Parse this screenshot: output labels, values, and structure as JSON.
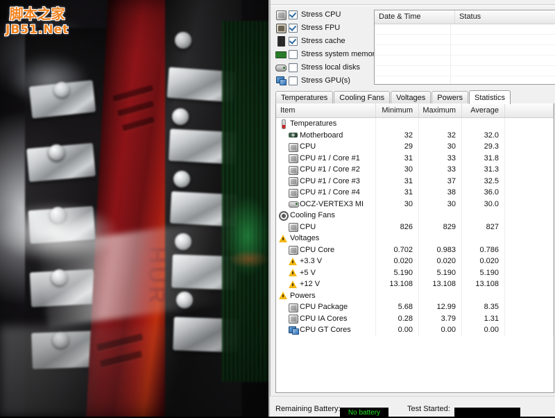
{
  "watermark": {
    "line1": "脚本之家",
    "line2": "JB51.Net"
  },
  "photo": {
    "alt": "blurred photo of frost-covered RAM heatsinks and motherboard"
  },
  "stress_options": [
    {
      "label": "Stress CPU",
      "icon": "cpu-icon",
      "checked": true
    },
    {
      "label": "Stress FPU",
      "icon": "fpu-icon",
      "checked": true
    },
    {
      "label": "Stress cache",
      "icon": "cache-icon",
      "checked": true
    },
    {
      "label": "Stress system memory",
      "icon": "memory-icon",
      "checked": false
    },
    {
      "label": "Stress local disks",
      "icon": "disk-icon",
      "checked": false
    },
    {
      "label": "Stress GPU(s)",
      "icon": "gpu-icon",
      "checked": false
    }
  ],
  "log": {
    "columns": [
      "Date & Time",
      "Status"
    ],
    "rows": []
  },
  "tabs": [
    {
      "label": "Temperatures",
      "active": false
    },
    {
      "label": "Cooling Fans",
      "active": false
    },
    {
      "label": "Voltages",
      "active": false
    },
    {
      "label": "Powers",
      "active": false
    },
    {
      "label": "Statistics",
      "active": true
    }
  ],
  "statistics": {
    "columns": [
      "Item",
      "Minimum",
      "Maximum",
      "Average"
    ],
    "rows": [
      {
        "type": "group",
        "icon": "thermometer-icon",
        "label": "Temperatures",
        "min": "",
        "max": "",
        "avg": ""
      },
      {
        "type": "item",
        "icon": "motherboard-icon",
        "label": "Motherboard",
        "min": "32",
        "max": "32",
        "avg": "32.0"
      },
      {
        "type": "item",
        "icon": "chip-icon",
        "label": "CPU",
        "min": "29",
        "max": "30",
        "avg": "29.3"
      },
      {
        "type": "item",
        "icon": "chip-icon",
        "label": "CPU #1 / Core #1",
        "min": "31",
        "max": "33",
        "avg": "31.8"
      },
      {
        "type": "item",
        "icon": "chip-icon",
        "label": "CPU #1 / Core #2",
        "min": "30",
        "max": "33",
        "avg": "31.3"
      },
      {
        "type": "item",
        "icon": "chip-icon",
        "label": "CPU #1 / Core #3",
        "min": "31",
        "max": "37",
        "avg": "32.5"
      },
      {
        "type": "item",
        "icon": "chip-icon",
        "label": "CPU #1 / Core #4",
        "min": "31",
        "max": "38",
        "avg": "36.0"
      },
      {
        "type": "item",
        "icon": "ssd-icon",
        "label": "OCZ-VERTEX3 MI",
        "min": "30",
        "max": "30",
        "avg": "30.0"
      },
      {
        "type": "group",
        "icon": "fan-icon",
        "label": "Cooling Fans",
        "min": "",
        "max": "",
        "avg": ""
      },
      {
        "type": "item",
        "icon": "chip-icon",
        "label": "CPU",
        "min": "826",
        "max": "829",
        "avg": "827"
      },
      {
        "type": "group",
        "icon": "warning-icon",
        "label": "Voltages",
        "min": "",
        "max": "",
        "avg": ""
      },
      {
        "type": "item",
        "icon": "chip-icon",
        "label": "CPU Core",
        "min": "0.702",
        "max": "0.983",
        "avg": "0.786"
      },
      {
        "type": "item",
        "icon": "warning-icon",
        "label": "+3.3 V",
        "min": "0.020",
        "max": "0.020",
        "avg": "0.020"
      },
      {
        "type": "item",
        "icon": "warning-icon",
        "label": "+5 V",
        "min": "5.190",
        "max": "5.190",
        "avg": "5.190"
      },
      {
        "type": "item",
        "icon": "warning-icon",
        "label": "+12 V",
        "min": "13.108",
        "max": "13.108",
        "avg": "13.108"
      },
      {
        "type": "group",
        "icon": "warning-icon",
        "label": "Powers",
        "min": "",
        "max": "",
        "avg": ""
      },
      {
        "type": "item",
        "icon": "chip-icon",
        "label": "CPU Package",
        "min": "5.68",
        "max": "12.99",
        "avg": "8.35"
      },
      {
        "type": "item",
        "icon": "chip-icon",
        "label": "CPU IA Cores",
        "min": "0.28",
        "max": "3.79",
        "avg": "1.31"
      },
      {
        "type": "item",
        "icon": "gpu-icon",
        "label": "CPU GT Cores",
        "min": "0.00",
        "max": "0.00",
        "avg": "0.00"
      }
    ]
  },
  "status_bar": {
    "battery_label": "Remaining Battery:",
    "battery_value": "No battery",
    "battery_value_color": "#23e023",
    "test_started_label": "Test Started:",
    "test_started_value": ""
  }
}
